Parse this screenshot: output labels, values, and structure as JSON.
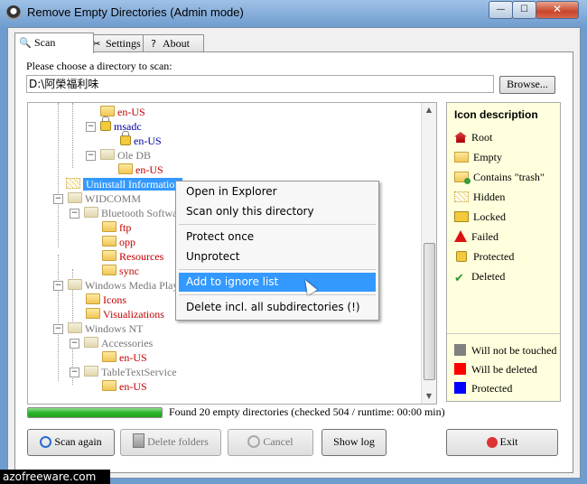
{
  "window": {
    "title": "Remove Empty Directories (Admin mode)",
    "controls": {
      "minimize": "—",
      "maximize": "☐",
      "close": "✕"
    }
  },
  "tabs": [
    {
      "label": "Scan",
      "icon": "magnifier-icon",
      "active": true
    },
    {
      "label": "Settings",
      "icon": "tools-icon",
      "active": false
    },
    {
      "label": "About",
      "icon": "help-icon",
      "active": false
    }
  ],
  "directory": {
    "label": "Please choose a directory to scan:",
    "value": "D:\\阿榮福利味",
    "browse_label": "Browse..."
  },
  "tree": {
    "items": [
      {
        "label": "en-US",
        "color": "red",
        "icon": "folder",
        "expander": ""
      },
      {
        "label": "msadc",
        "color": "blue",
        "icon": "lock",
        "expander": "⊟"
      },
      {
        "label": "en-US",
        "color": "blue",
        "icon": "lock",
        "expander": ""
      },
      {
        "label": "Ole DB",
        "color": "gray",
        "icon": "folder",
        "expander": "⊟"
      },
      {
        "label": "en-US",
        "color": "red",
        "icon": "folder",
        "expander": ""
      },
      {
        "label": "Uninstall Information",
        "color": "selected",
        "icon": "hidden",
        "expander": ""
      },
      {
        "label": "WIDCOMM",
        "color": "gray",
        "icon": "folder",
        "expander": "⊟"
      },
      {
        "label": "Bluetooth Softwa",
        "color": "gray",
        "icon": "folder",
        "expander": "⊟"
      },
      {
        "label": "ftp",
        "color": "red",
        "icon": "folder",
        "expander": ""
      },
      {
        "label": "opp",
        "color": "red",
        "icon": "folder",
        "expander": ""
      },
      {
        "label": "Resources",
        "color": "red",
        "icon": "folder",
        "expander": ""
      },
      {
        "label": "sync",
        "color": "red",
        "icon": "folder",
        "expander": ""
      },
      {
        "label": "Windows Media Playe",
        "color": "gray",
        "icon": "folder",
        "expander": "⊟"
      },
      {
        "label": "Icons",
        "color": "red",
        "icon": "folder",
        "expander": ""
      },
      {
        "label": "Visualizations",
        "color": "red",
        "icon": "folder",
        "expander": ""
      },
      {
        "label": "Windows NT",
        "color": "gray",
        "icon": "folder",
        "expander": "⊟"
      },
      {
        "label": "Accessories",
        "color": "gray",
        "icon": "folder",
        "expander": "⊟"
      },
      {
        "label": "en-US",
        "color": "red",
        "icon": "folder",
        "expander": ""
      },
      {
        "label": "TableTextService",
        "color": "gray",
        "icon": "folder",
        "expander": "⊟"
      },
      {
        "label": "en-US",
        "color": "red",
        "icon": "folder",
        "expander": ""
      }
    ]
  },
  "context_menu": {
    "items": [
      "Open in Explorer",
      "Scan only this directory",
      "Protect once",
      "Unprotect",
      "Add to ignore list",
      "Delete incl. all subdirectories (!)"
    ],
    "highlighted": "Add to ignore list"
  },
  "icon_description": {
    "title": "Icon description",
    "items": [
      {
        "label": "Root",
        "icon": "root-icon"
      },
      {
        "label": "Empty",
        "icon": "empty-folder-icon"
      },
      {
        "label": "Contains \"trash\"",
        "icon": "trash-folder-icon"
      },
      {
        "label": "Hidden",
        "icon": "hidden-folder-icon"
      },
      {
        "label": "Locked",
        "icon": "locked-folder-icon"
      },
      {
        "label": "Failed",
        "icon": "warning-icon"
      },
      {
        "label": "Protected",
        "icon": "padlock-icon"
      },
      {
        "label": "Deleted",
        "icon": "checkmark-icon"
      }
    ],
    "legend": [
      {
        "label": "Will not be touched",
        "color": "#808080"
      },
      {
        "label": "Will be deleted",
        "color": "#ff0000"
      },
      {
        "label": "Protected",
        "color": "#0000ff"
      }
    ]
  },
  "status": {
    "progress_fraction": 1.0,
    "text": "Found 20 empty directories (checked 504 / runtime: 00:00 min)"
  },
  "buttons": {
    "scan_again": "Scan again",
    "delete_folders": "Delete folders",
    "cancel": "Cancel",
    "show_log": "Show log",
    "exit": "Exit"
  },
  "watermark": "azofreeware.com"
}
